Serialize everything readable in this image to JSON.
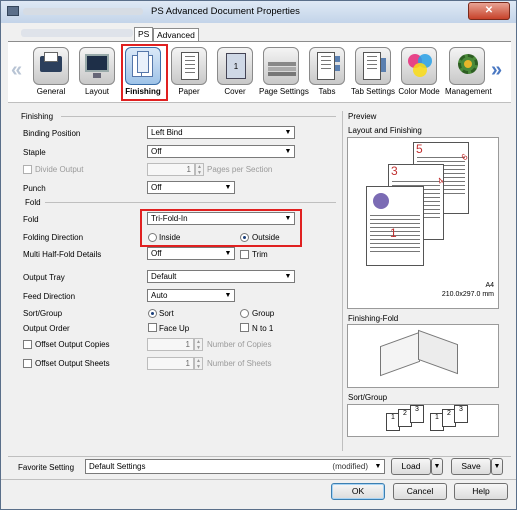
{
  "window": {
    "title": "PS Advanced Document Properties",
    "close_label": "✕"
  },
  "tabs": [
    {
      "label": "PS"
    },
    {
      "label": "Advanced"
    }
  ],
  "iconbar": [
    {
      "label": "General",
      "icon": "printer-photo-icon"
    },
    {
      "label": "Layout",
      "icon": "layout-monitor-icon"
    },
    {
      "label": "Finishing",
      "icon": "finishing-pages-icon"
    },
    {
      "label": "Paper",
      "icon": "paper-icon"
    },
    {
      "label": "Cover",
      "icon": "cover-icon"
    },
    {
      "label": "Page Settings",
      "icon": "page-stack-icon"
    },
    {
      "label": "Tabs",
      "icon": "tabs-icon"
    },
    {
      "label": "Tab Settings",
      "icon": "tab-settings-icon"
    },
    {
      "label": "Color Mode",
      "icon": "color-circles-icon"
    },
    {
      "label": "Management",
      "icon": "gear-management-icon"
    }
  ],
  "finishing": {
    "section": "Finishing",
    "binding_label": "Binding Position",
    "binding_value": "Left Bind",
    "staple_label": "Staple",
    "staple_value": "Off",
    "divide_label": "Divide Output",
    "divide_value": "1",
    "divide_unit": "Pages per Section",
    "punch_label": "Punch",
    "punch_value": "Off",
    "fold_section": "Fold",
    "fold_label": "Fold",
    "fold_value": "Tri-Fold-In",
    "direction_label": "Folding Direction",
    "inside_label": "Inside",
    "outside_label": "Outside",
    "multi_label": "Multi Half-Fold Details",
    "multi_value": "Off",
    "trim_label": "Trim",
    "tray_label": "Output Tray",
    "tray_value": "Default",
    "feed_label": "Feed Direction",
    "feed_value": "Auto",
    "sortgroup_label": "Sort/Group",
    "sort_label": "Sort",
    "group_label": "Group",
    "order_label": "Output Order",
    "faceup_label": "Face Up",
    "nto1_label": "N to 1",
    "offset_copies_label": "Offset Output Copies",
    "offset_copies_value": "1",
    "offset_copies_unit": "Number of Copies",
    "offset_sheets_label": "Offset Output Sheets",
    "offset_sheets_value": "1",
    "offset_sheets_unit": "Number of Sheets"
  },
  "preview": {
    "section": "Preview",
    "layout_label": "Layout and Finishing",
    "pages": [
      "1",
      "3",
      "4",
      "5",
      "6"
    ],
    "paper_name": "A4",
    "paper_size": "210.0x297.0 mm",
    "fold_label": "Finishing-Fold",
    "sortgroup_label": "Sort/Group",
    "sort_pages": [
      "1",
      "2",
      "3"
    ]
  },
  "favorite": {
    "label": "Favorite Setting",
    "value": "Default Settings",
    "status": "(modified)",
    "load_label": "Load",
    "save_label": "Save"
  },
  "buttons": {
    "ok": "OK",
    "cancel": "Cancel",
    "help": "Help"
  },
  "colors": {
    "highlight": "#e02020",
    "accent": "#3a6ea8",
    "title_gradient": "#c3d4e9"
  }
}
